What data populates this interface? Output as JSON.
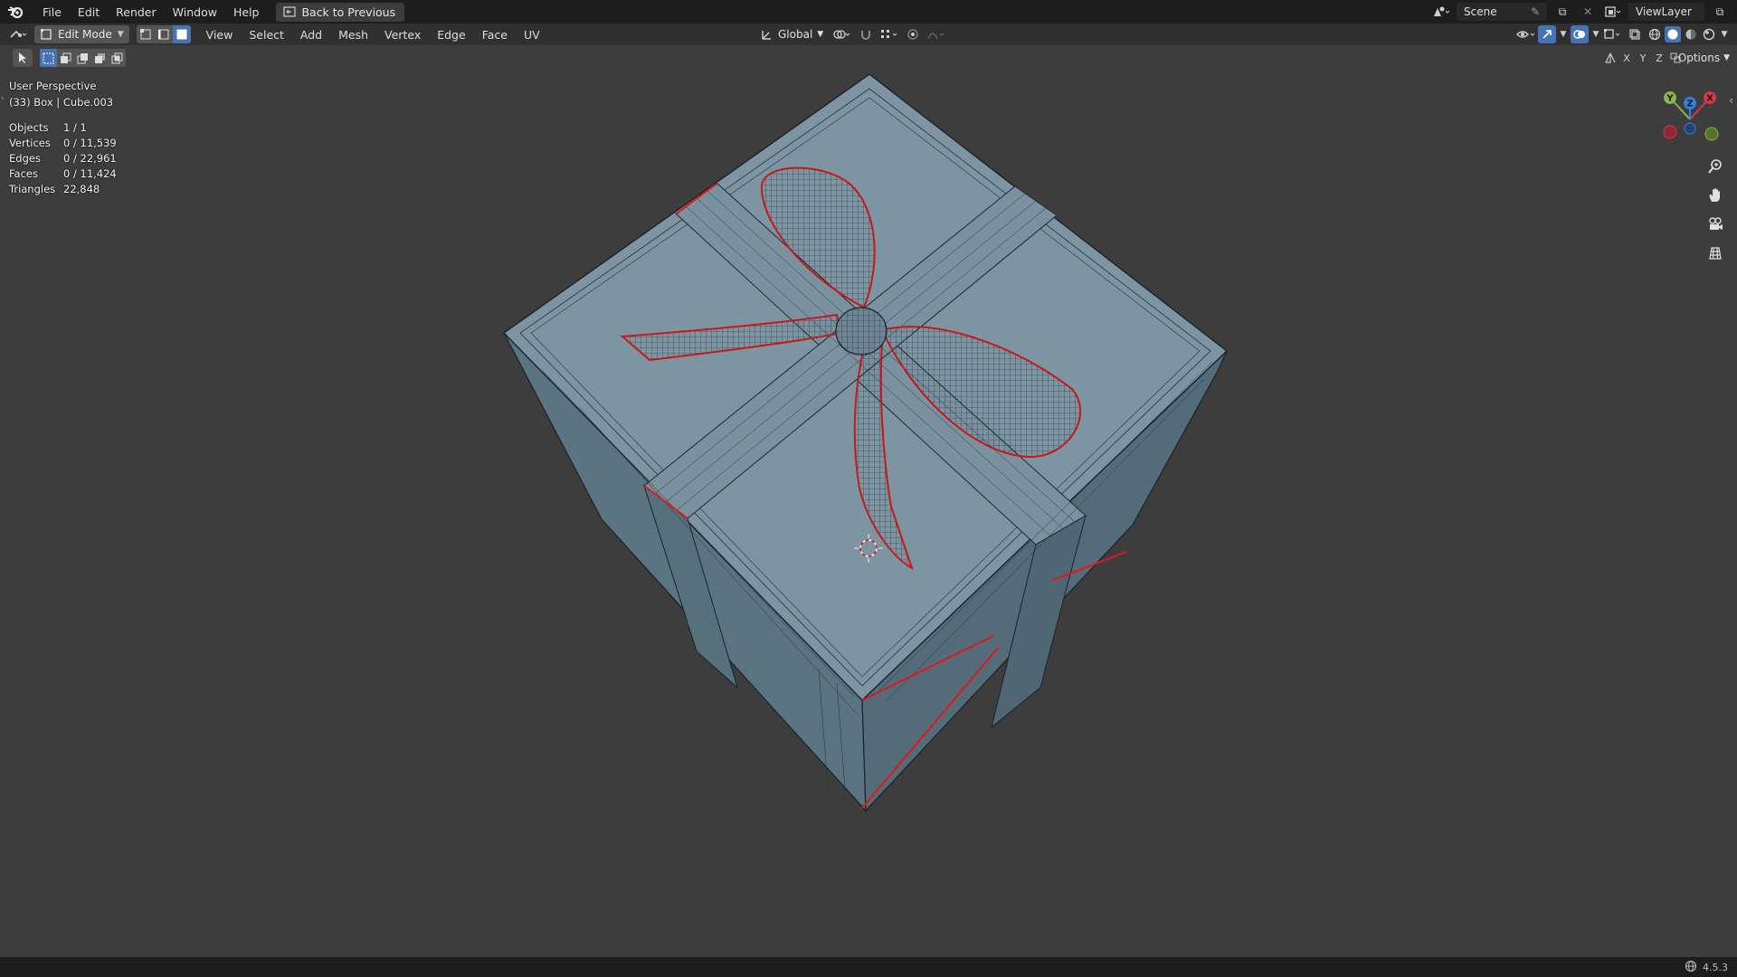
{
  "topbar": {
    "menus": [
      "File",
      "Edit",
      "Render",
      "Window",
      "Help"
    ],
    "back_button": "Back to Previous",
    "scene": "Scene",
    "view_layer": "ViewLayer"
  },
  "header": {
    "mode": "Edit Mode",
    "menus": [
      "View",
      "Select",
      "Add",
      "Mesh",
      "Vertex",
      "Edge",
      "Face",
      "UV"
    ],
    "orientation": "Global",
    "axis_x": "X",
    "axis_y": "Y",
    "axis_z": "Z",
    "options": "Options"
  },
  "viewport": {
    "view_name": "User Perspective",
    "object_info": "(33) Box | Cube.003",
    "stats": [
      {
        "label": "Objects",
        "value": "1 / 1"
      },
      {
        "label": "Vertices",
        "value": "0 / 11,539"
      },
      {
        "label": "Edges",
        "value": "0 / 22,961"
      },
      {
        "label": "Faces",
        "value": "0 / 11,424"
      },
      {
        "label": "Triangles",
        "value": "22,848"
      }
    ],
    "gizmo": {
      "x": "X",
      "y": "Y",
      "z": "Z"
    }
  },
  "statusbar": {
    "version": "4.5.3"
  },
  "colors": {
    "mesh_fill": "#7f98a6",
    "mesh_side": "#5d7584",
    "wire": "#1c2329",
    "seam": "#e01818",
    "accent": "#4772b3"
  }
}
